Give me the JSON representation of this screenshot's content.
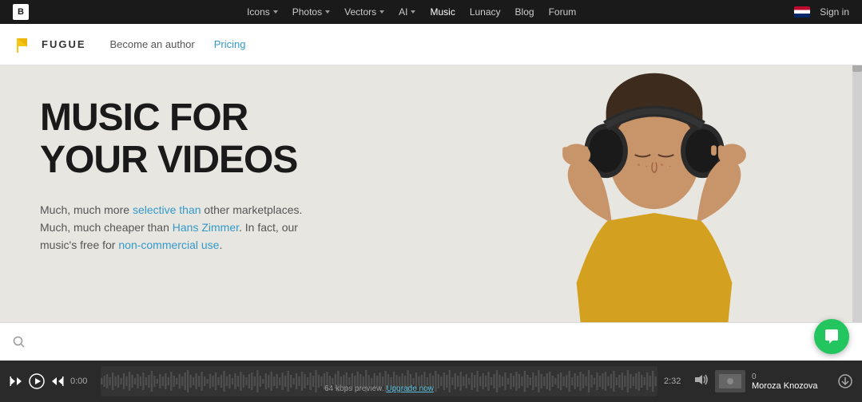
{
  "top_nav": {
    "brand": "B",
    "items": [
      {
        "label": "Icons",
        "has_dropdown": true
      },
      {
        "label": "Photos",
        "has_dropdown": true
      },
      {
        "label": "Vectors",
        "has_dropdown": true
      },
      {
        "label": "AI",
        "has_dropdown": true
      },
      {
        "label": "Music",
        "active": true
      },
      {
        "label": "Lunacy",
        "has_dropdown": false
      },
      {
        "label": "Blog",
        "has_dropdown": false
      },
      {
        "label": "Forum",
        "has_dropdown": false
      }
    ],
    "sign_in": "Sign in"
  },
  "second_nav": {
    "logo_text": "FUGUE",
    "links": [
      {
        "label": "Become an author",
        "class": ""
      },
      {
        "label": "Pricing",
        "class": "pricing"
      }
    ]
  },
  "hero": {
    "title_line1": "MUSIC FOR",
    "title_line2": "YOUR VIDEOS",
    "subtitle": "Much, much more selective than other marketplaces. Much, much cheaper than Hans Zimmer. In fact, our music's free for non-commercial use.",
    "highlight_words": [
      "selective",
      "than",
      "Hans Zimmer",
      "non-commercial use"
    ]
  },
  "player": {
    "time_start": "0:00",
    "time_end": "2:32",
    "preview_text": "64 kbps preview.",
    "upgrade_text": "Upgrade now",
    "track_count": "0",
    "track_name": "Moroza Knozova"
  },
  "search": {
    "placeholder": ""
  }
}
